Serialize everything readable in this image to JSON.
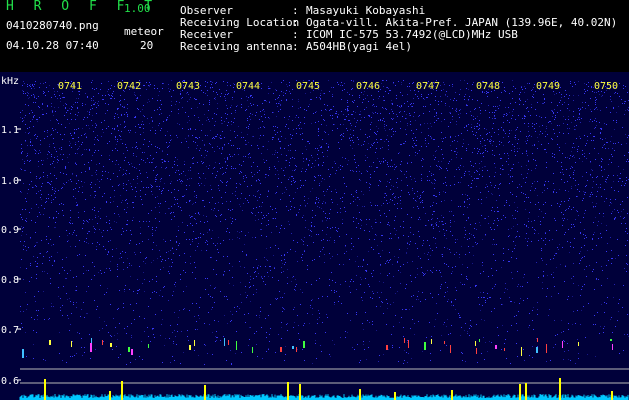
{
  "app": {
    "title": "H R O F F T",
    "version": "1.00",
    "filename": "0410280740.png",
    "datetime": "04.10.28 07:40",
    "meteor_label": "meteor",
    "meteor_count": "20"
  },
  "info": {
    "rows": [
      {
        "label": "Observer",
        "sep": ":",
        "value": "Masayuki Kobayashi"
      },
      {
        "label": "Receiving Location",
        "sep": ":",
        "value": "Ogata-vill. Akita-Pref. JAPAN (139.96E, 40.02N)"
      },
      {
        "label": "Receiver",
        "sep": ":",
        "value": "ICOM IC-575 53.7492(@LCD)MHz USB"
      },
      {
        "label": "Receiving antenna",
        "sep": ":",
        "value": "A504HB(yagi 4el)"
      }
    ]
  },
  "spectrogram": {
    "y_unit": "kHz",
    "y_ticks": [
      "1.1",
      "1.0",
      "0.9",
      "0.8",
      "0.7",
      "0.6"
    ],
    "time_ticks": [
      "0741",
      "0742",
      "0743",
      "0744",
      "0745",
      "0746",
      "0747",
      "0748",
      "0749",
      "0750"
    ],
    "colors": {
      "background": "#00003a",
      "noise": "#3a3aff",
      "axis_text": "#ffffff",
      "time_text": "#ffff40",
      "meteor": "#ffff00",
      "baseline": "#00c8ff"
    }
  }
}
